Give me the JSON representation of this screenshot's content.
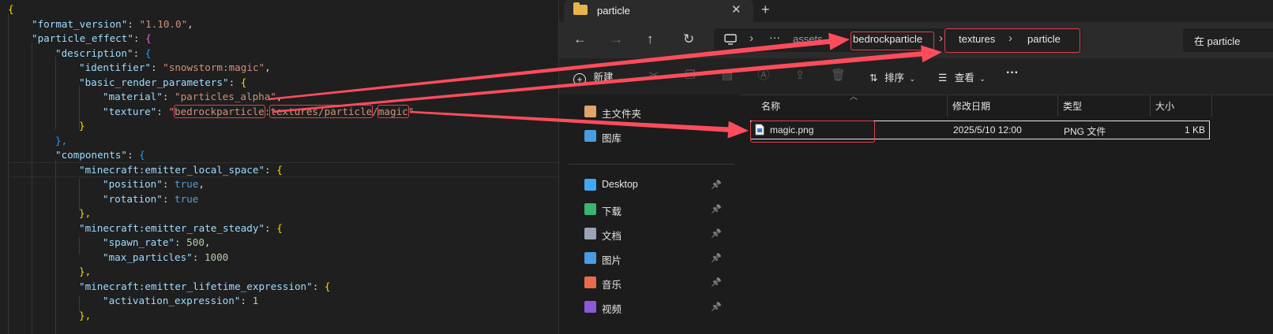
{
  "editor": {
    "lines": [
      [
        [
          "b1",
          "{"
        ]
      ],
      [
        [
          "k",
          "\"format_version\""
        ],
        [
          "p",
          ": "
        ],
        [
          "s",
          "\"1.10.0\""
        ],
        [
          "p",
          ","
        ]
      ],
      [
        [
          "k",
          "\"particle_effect\""
        ],
        [
          "p",
          ": "
        ],
        [
          "b2",
          "{"
        ]
      ],
      [
        [
          "k",
          "\"description\""
        ],
        [
          "p",
          ": "
        ],
        [
          "b3",
          "{"
        ]
      ],
      [
        [
          "k",
          "\"identifier\""
        ],
        [
          "p",
          ": "
        ],
        [
          "s",
          "\"snowstorm:magic\""
        ],
        [
          "p",
          ","
        ]
      ],
      [
        [
          "k",
          "\"basic_render_parameters\""
        ],
        [
          "p",
          ": "
        ],
        [
          "b1",
          "{"
        ]
      ],
      [
        [
          "k",
          "\"material\""
        ],
        [
          "p",
          ": "
        ],
        [
          "s",
          "\"particles_alpha\""
        ],
        [
          "p",
          ","
        ]
      ],
      [
        [
          "k",
          "\"texture\""
        ],
        [
          "p",
          ": "
        ],
        [
          "s",
          "\""
        ],
        [
          "s hl",
          "bedrockparticle"
        ],
        [
          "s",
          ":"
        ],
        [
          "s hl",
          "textures/particle"
        ],
        [
          "s",
          "/"
        ],
        [
          "s hl",
          "magic"
        ],
        [
          "s",
          "\""
        ]
      ],
      [
        [
          "b1",
          "}"
        ]
      ],
      [
        [
          "b3",
          "},"
        ]
      ],
      [
        [
          "k",
          "\"components\""
        ],
        [
          "p",
          ": "
        ],
        [
          "b3",
          "{"
        ]
      ],
      [
        [
          "k",
          "\"minecraft:emitter_local_space\""
        ],
        [
          "p",
          ": "
        ],
        [
          "b1",
          "{"
        ]
      ],
      [
        [
          "k",
          "\"position\""
        ],
        [
          "p",
          ": "
        ],
        [
          "b",
          "true"
        ],
        [
          "p",
          ","
        ]
      ],
      [
        [
          "k",
          "\"rotation\""
        ],
        [
          "p",
          ": "
        ],
        [
          "b",
          "true"
        ]
      ],
      [
        [
          "b1",
          "},"
        ]
      ],
      [
        [
          "k",
          "\"minecraft:emitter_rate_steady\""
        ],
        [
          "p",
          ": "
        ],
        [
          "b1",
          "{"
        ]
      ],
      [
        [
          "k",
          "\"spawn_rate\""
        ],
        [
          "p",
          ": "
        ],
        [
          "n",
          "500"
        ],
        [
          "p",
          ","
        ]
      ],
      [
        [
          "k",
          "\"max_particles\""
        ],
        [
          "p",
          ": "
        ],
        [
          "n",
          "1000"
        ]
      ],
      [
        [
          "b1",
          "},"
        ]
      ],
      [
        [
          "k",
          "\"minecraft:emitter_lifetime_expression\""
        ],
        [
          "p",
          ": "
        ],
        [
          "b1",
          "{"
        ]
      ],
      [
        [
          "k",
          "\"activation_expression\""
        ],
        [
          "p",
          ": "
        ],
        [
          "n",
          "1"
        ]
      ],
      [
        [
          "b1",
          "},"
        ]
      ]
    ]
  },
  "explorer": {
    "tab_title": "particle",
    "address": {
      "ellipsis": "···",
      "assets": "assets",
      "bedrockparticle": "bedrockparticle",
      "textures": "textures",
      "particle": "particle"
    },
    "search_placeholder": "在 particle",
    "toolbar": {
      "new": "新建",
      "sort": "排序",
      "view": "查看",
      "more": "···"
    },
    "nav": [
      {
        "label": "主文件夹",
        "icon": "home-icon",
        "pinned": false
      },
      {
        "label": "图库",
        "icon": "gallery-icon",
        "pinned": false
      },
      {
        "label": "Desktop",
        "icon": "desktop-icon",
        "pinned": true
      },
      {
        "label": "下载",
        "icon": "download-icon",
        "pinned": true
      },
      {
        "label": "文档",
        "icon": "documents-icon",
        "pinned": true
      },
      {
        "label": "图片",
        "icon": "pictures-icon",
        "pinned": true
      },
      {
        "label": "音乐",
        "icon": "music-icon",
        "pinned": true
      },
      {
        "label": "视频",
        "icon": "videos-icon",
        "pinned": true
      }
    ],
    "columns": {
      "name": "名称",
      "modified": "修改日期",
      "type": "类型",
      "size": "大小"
    },
    "files": [
      {
        "name": "magic.png",
        "modified": "2025/5/10 12:00",
        "type": "PNG 文件",
        "size": "1 KB"
      }
    ]
  },
  "colors": {
    "annotation": "#ff4c5c",
    "highlight_box": "#d9434f"
  }
}
